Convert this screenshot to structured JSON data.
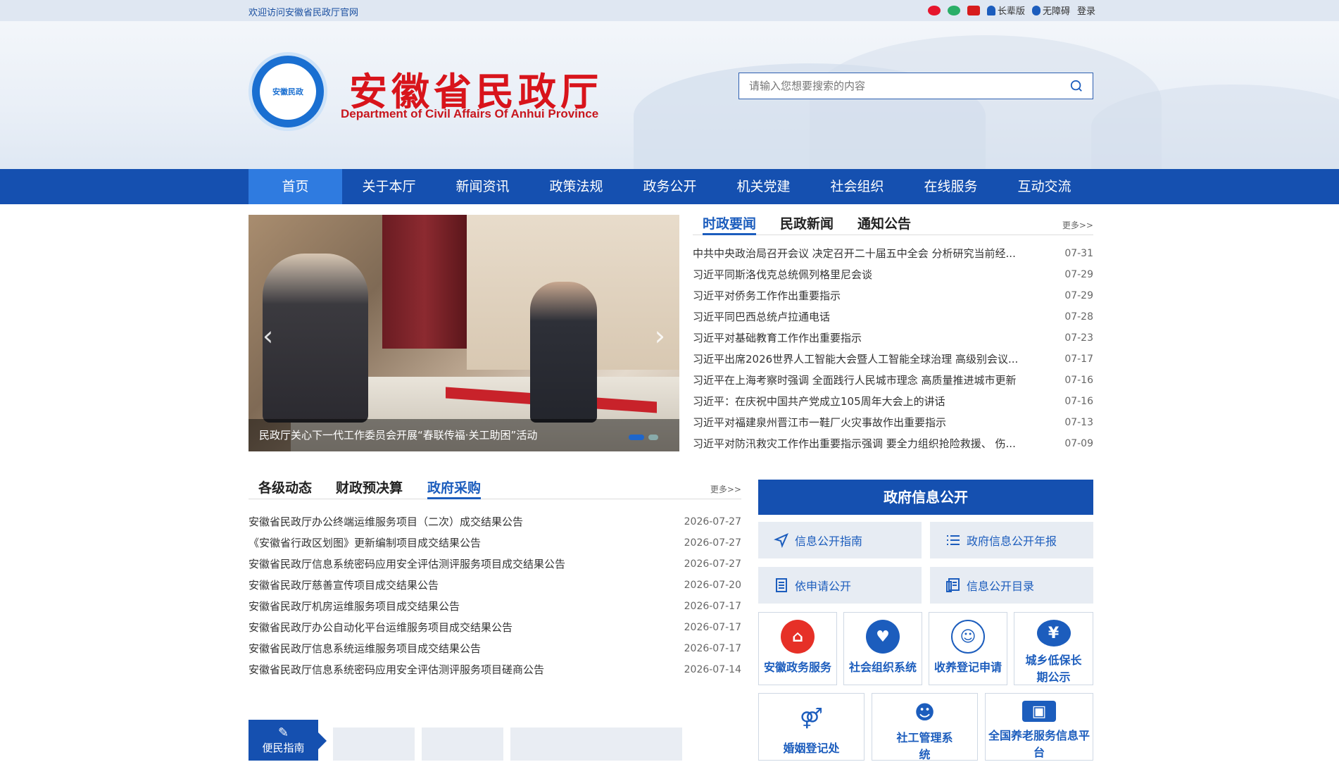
{
  "topbar": {
    "welcome": "欢迎访问安徽省民政厅官网",
    "tools": {
      "elder": "长辈版",
      "access": "无障碍",
      "login": "登录"
    }
  },
  "header": {
    "title": "安徽省民政厅",
    "subtitle": "Department of Civil Affairs Of Anhui Province",
    "logo_text": "安徽民政",
    "search_placeholder": "请输入您想要搜索的内容"
  },
  "nav": [
    "首页",
    "关于本厅",
    "新闻资讯",
    "政策法规",
    "政务公开",
    "机关党建",
    "社会组织",
    "在线服务",
    "互动交流"
  ],
  "slider": {
    "caption": "民政厅关心下一代工作委员会开展“春联传福·关工助困”活动"
  },
  "news1": {
    "tabs": [
      "时政要闻",
      "民政新闻",
      "通知公告"
    ],
    "more": "更多>>",
    "items": [
      {
        "title": "中共中央政治局召开会议 决定召开二十届五中全会 分析研究当前经...",
        "date": "07-31"
      },
      {
        "title": "习近平同斯洛伐克总统佩列格里尼会谈",
        "date": "07-29"
      },
      {
        "title": "习近平对侨务工作作出重要指示",
        "date": "07-29"
      },
      {
        "title": "习近平同巴西总统卢拉通电话",
        "date": "07-28"
      },
      {
        "title": "习近平对基础教育工作作出重要指示",
        "date": "07-23"
      },
      {
        "title": "习近平出席2026世界人工智能大会暨人工智能全球治理 高级别会议...",
        "date": "07-17"
      },
      {
        "title": "习近平在上海考察时强调 全面践行人民城市理念 高质量推进城市更新",
        "date": "07-16"
      },
      {
        "title": "习近平：在庆祝中国共产党成立105周年大会上的讲话",
        "date": "07-16"
      },
      {
        "title": "习近平对福建泉州晋江市一鞋厂火灾事故作出重要指示",
        "date": "07-13"
      },
      {
        "title": "习近平对防汛救灾工作作出重要指示强调 要全力组织抢险救援、 伤...",
        "date": "07-09"
      }
    ]
  },
  "news2": {
    "tabs": [
      "各级动态",
      "财政预决算",
      "政府采购"
    ],
    "more": "更多>>",
    "items": [
      {
        "title": "安徽省民政厅办公终端运维服务项目（二次）成交结果公告",
        "date": "2026-07-27"
      },
      {
        "title": "《安徽省行政区划图》更新编制项目成交结果公告",
        "date": "2026-07-27"
      },
      {
        "title": "安徽省民政厅信息系统密码应用安全评估测评服务项目成交结果公告",
        "date": "2026-07-27"
      },
      {
        "title": "安徽省民政厅慈善宣传项目成交结果公告",
        "date": "2026-07-20"
      },
      {
        "title": "安徽省民政厅机房运维服务项目成交结果公告",
        "date": "2026-07-17"
      },
      {
        "title": "安徽省民政厅办公自动化平台运维服务项目成交结果公告",
        "date": "2026-07-17"
      },
      {
        "title": "安徽省民政厅信息系统运维服务项目成交结果公告",
        "date": "2026-07-17"
      },
      {
        "title": "安徽省民政厅信息系统密码应用安全评估测评服务项目磋商公告",
        "date": "2026-07-14"
      }
    ]
  },
  "gov": {
    "title": "政府信息公开",
    "buttons": [
      "信息公开指南",
      "政府信息公开年报",
      "依申请公开",
      "信息公开目录"
    ]
  },
  "services": [
    {
      "label": "安徽政务服务",
      "color": "#e63027"
    },
    {
      "label": "社会组织系统",
      "color": "#1c5dbd"
    },
    {
      "label": "收养登记申请",
      "color": "#1c5dbd"
    },
    {
      "label": "城乡低保长期公示",
      "color": "#1c5dbd"
    },
    {
      "label": "婚姻登记处",
      "color": "#1c5dbd"
    },
    {
      "label": "社工管理系统",
      "color": "#1c5dbd"
    },
    {
      "label": "全国养老服务信息平台",
      "color": "#1c5dbd"
    }
  ],
  "bottom": {
    "tab": "便民指南"
  }
}
